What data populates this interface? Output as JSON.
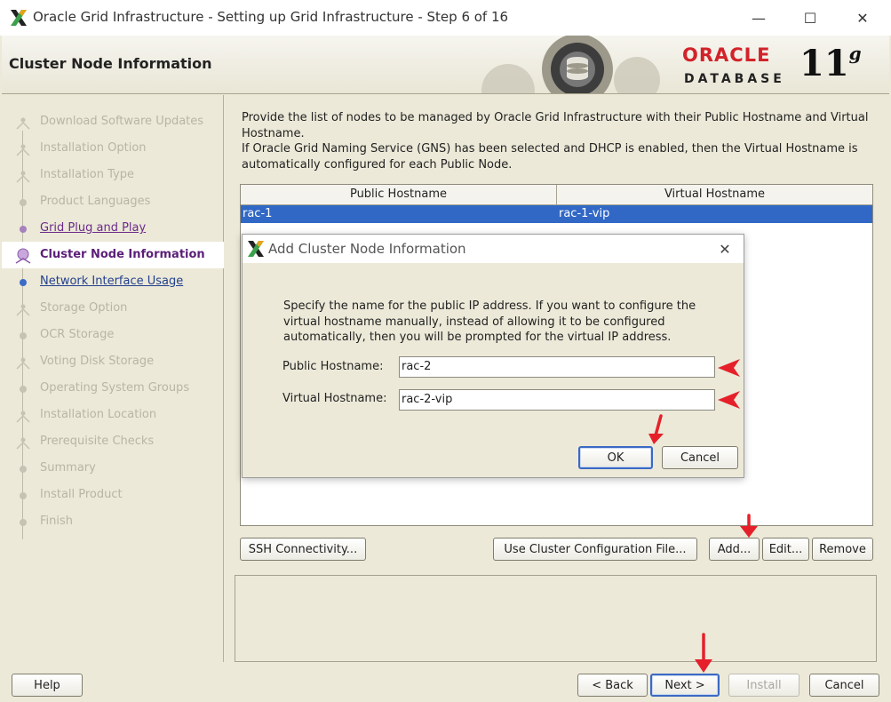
{
  "window": {
    "title": "Oracle Grid Infrastructure - Setting up Grid Infrastructure - Step 6 of 16",
    "minimize_glyph": "—",
    "maximize_glyph": "☐",
    "close_glyph": "✕"
  },
  "banner": {
    "title": "Cluster Node Information",
    "brand": "ORACLE",
    "product": "DATABASE",
    "version": "11",
    "version_suffix": "g"
  },
  "steps": [
    {
      "label": "Download Software Updates",
      "state": "disabled",
      "icon": "person-icon"
    },
    {
      "label": "Installation Option",
      "state": "disabled",
      "icon": "person-icon"
    },
    {
      "label": "Installation Type",
      "state": "disabled",
      "icon": "person-icon"
    },
    {
      "label": "Product Languages",
      "state": "disabled",
      "icon": "dot-icon"
    },
    {
      "label": "Grid Plug and Play",
      "state": "done-link",
      "icon": "dot-icon"
    },
    {
      "label": "Cluster Node Information",
      "state": "current",
      "icon": "current-step-icon"
    },
    {
      "label": "Network Interface Usage",
      "state": "next-link",
      "icon": "dot-icon"
    },
    {
      "label": "Storage Option",
      "state": "disabled",
      "icon": "person-icon"
    },
    {
      "label": "OCR Storage",
      "state": "disabled",
      "icon": "dot-icon"
    },
    {
      "label": "Voting Disk Storage",
      "state": "disabled",
      "icon": "person-icon"
    },
    {
      "label": "Operating System Groups",
      "state": "disabled",
      "icon": "dot-icon"
    },
    {
      "label": "Installation Location",
      "state": "disabled",
      "icon": "person-icon"
    },
    {
      "label": "Prerequisite Checks",
      "state": "disabled",
      "icon": "person-icon"
    },
    {
      "label": "Summary",
      "state": "disabled",
      "icon": "dot-icon"
    },
    {
      "label": "Install Product",
      "state": "disabled",
      "icon": "dot-icon"
    },
    {
      "label": "Finish",
      "state": "disabled",
      "icon": "dot-icon"
    }
  ],
  "main": {
    "description_line1": "Provide the list of nodes to be managed by Oracle Grid Infrastructure with their Public Hostname and Virtual Hostname.",
    "description_line2": "If Oracle Grid Naming Service (GNS) has been selected and DHCP is enabled, then the Virtual Hostname is automatically configured for each Public Node.",
    "table": {
      "columns": [
        "Public Hostname",
        "Virtual Hostname"
      ],
      "rows": [
        {
          "public": "rac-1",
          "virtual": "rac-1-vip",
          "selected": true
        }
      ]
    },
    "buttons": {
      "ssh": "SSH Connectivity...",
      "use_config": "Use Cluster Configuration File...",
      "add": "Add...",
      "edit": "Edit...",
      "remove": "Remove"
    }
  },
  "dialog": {
    "title": "Add Cluster Node Information",
    "close_glyph": "✕",
    "description": "Specify the name for the public IP address. If you want to configure the virtual hostname manually, instead of allowing it to be configured automatically, then you will be prompted for the virtual IP address.",
    "public_label": "Public Hostname:",
    "public_value": "rac-2",
    "virtual_label": "Virtual Hostname:",
    "virtual_value": "rac-2-vip",
    "ok": "OK",
    "cancel": "Cancel"
  },
  "footer": {
    "help": "Help",
    "back": "< Back",
    "next": "Next >",
    "install": "Install",
    "cancel": "Cancel"
  },
  "colors": {
    "selection": "#3168c6",
    "annotation_arrow": "#e5202a",
    "oracle_red": "#d2232a"
  }
}
